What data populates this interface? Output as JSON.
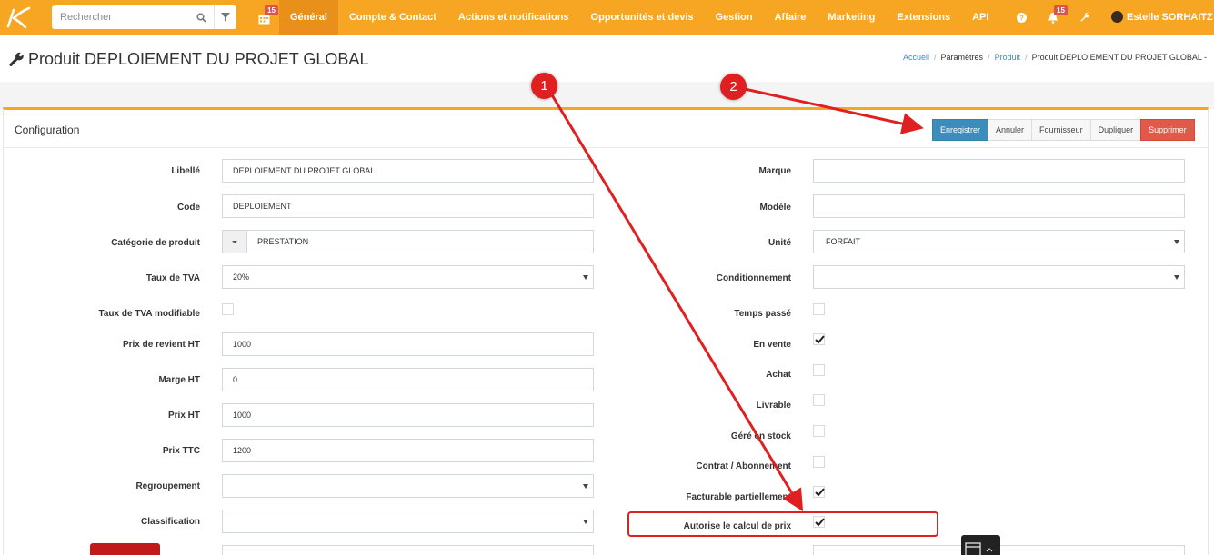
{
  "nav": {
    "search_placeholder": "Rechercher",
    "calendar_badge": "15",
    "notif_badge": "15",
    "menu": [
      "Général",
      "Compte & Contact",
      "Actions et notifications",
      "Opportunités et devis",
      "Gestion",
      "Affaire",
      "Marketing",
      "Extensions",
      "API"
    ],
    "user_name": "Estelle SORHAITZ"
  },
  "page": {
    "title": "Produit DEPLOIEMENT DU PROJET GLOBAL",
    "breadcrumb": [
      "Accueil",
      "Paramètres",
      "Produit",
      "Produit DEPLOIEMENT DU PROJET GLOBAL -"
    ]
  },
  "panel": {
    "title": "Configuration",
    "buttons": {
      "save": "Enregistrer",
      "cancel": "Annuler",
      "supplier": "Fournisseur",
      "duplicate": "Dupliquer",
      "delete": "Supprimer"
    }
  },
  "form_left": {
    "libelle": {
      "label": "Libellé",
      "value": "DEPLOIEMENT DU PROJET GLOBAL"
    },
    "code": {
      "label": "Code",
      "value": "DEPLOIEMENT"
    },
    "categorie": {
      "label": "Catégorie de produit",
      "value": "PRESTATION"
    },
    "tva": {
      "label": "Taux de TVA",
      "value": "20%"
    },
    "tva_modifiable": {
      "label": "Taux de TVA modifiable",
      "checked": false
    },
    "prix_revient": {
      "label": "Prix de revient HT",
      "value": "1000"
    },
    "marge": {
      "label": "Marge HT",
      "value": "0"
    },
    "prix_ht": {
      "label": "Prix HT",
      "value": "1000"
    },
    "prix_ttc": {
      "label": "Prix TTC",
      "value": "1200"
    },
    "regroupement": {
      "label": "Regroupement",
      "value": ""
    },
    "classification": {
      "label": "Classification",
      "value": ""
    }
  },
  "form_right": {
    "marque": {
      "label": "Marque",
      "value": ""
    },
    "modele": {
      "label": "Modèle",
      "value": ""
    },
    "unite": {
      "label": "Unité",
      "value": "FORFAIT"
    },
    "conditionnement": {
      "label": "Conditionnement",
      "value": ""
    },
    "temps_passe": {
      "label": "Temps passé",
      "checked": false
    },
    "en_vente": {
      "label": "En vente",
      "checked": true
    },
    "achat": {
      "label": "Achat",
      "checked": false
    },
    "livrable": {
      "label": "Livrable",
      "checked": false
    },
    "gere_stock": {
      "label": "Géré en stock",
      "checked": false
    },
    "contrat": {
      "label": "Contrat / Abonnement",
      "checked": false
    },
    "facturable": {
      "label": "Facturable partiellement",
      "checked": true
    },
    "autorise_calcul": {
      "label": "Autorise le calcul de prix",
      "checked": true
    }
  },
  "annotations": {
    "marker1": "1",
    "marker2": "2"
  },
  "colors": {
    "navbar": "#f6a623",
    "primary": "#3c8dbc",
    "danger": "#e05a4c",
    "annotation": "#e02020"
  },
  "icons": [
    "logo-icon",
    "search-icon",
    "filter-icon",
    "calendar-icon",
    "help-icon",
    "bell-icon",
    "wrench-icon"
  ]
}
